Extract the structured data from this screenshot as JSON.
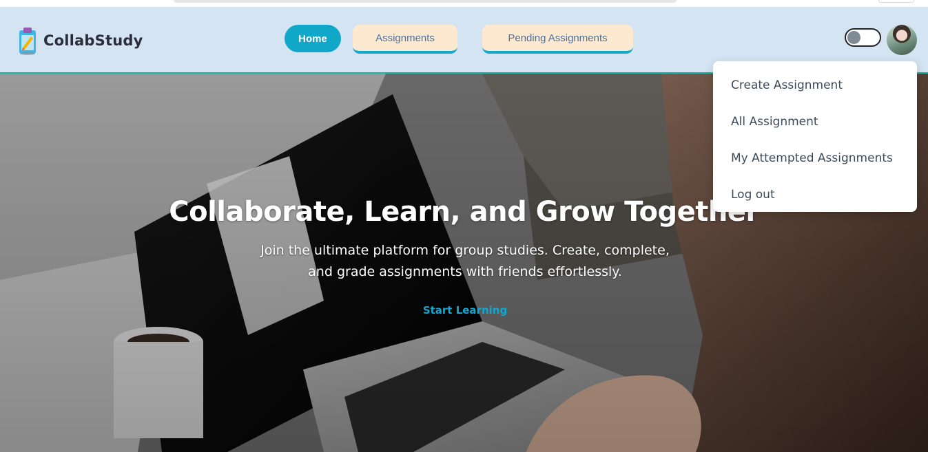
{
  "brand": {
    "name": "CollabStudy",
    "icon": "clipboard-pencil-icon"
  },
  "nav": {
    "home": "Home",
    "assignments": "Assignments",
    "pending": "Pending Assignments"
  },
  "theme_toggle": {
    "state": "off"
  },
  "user_menu": {
    "items": [
      "Create Assignment",
      "All Assignment",
      "My Attempted Assignments",
      "Log out"
    ]
  },
  "hero": {
    "title": "Collaborate, Learn, and Grow Together",
    "subtitle": "Join the ultimate platform for group studies. Create, complete, and grade assignments with friends effortlessly.",
    "cta": "Start Learning"
  },
  "colors": {
    "navbar_bg": "#d4e4f2",
    "accent": "#11a7c9",
    "nav_button_bg": "#fde9cf",
    "nav_button_text": "#4d6f98",
    "navbar_border": "#22b3a4"
  }
}
